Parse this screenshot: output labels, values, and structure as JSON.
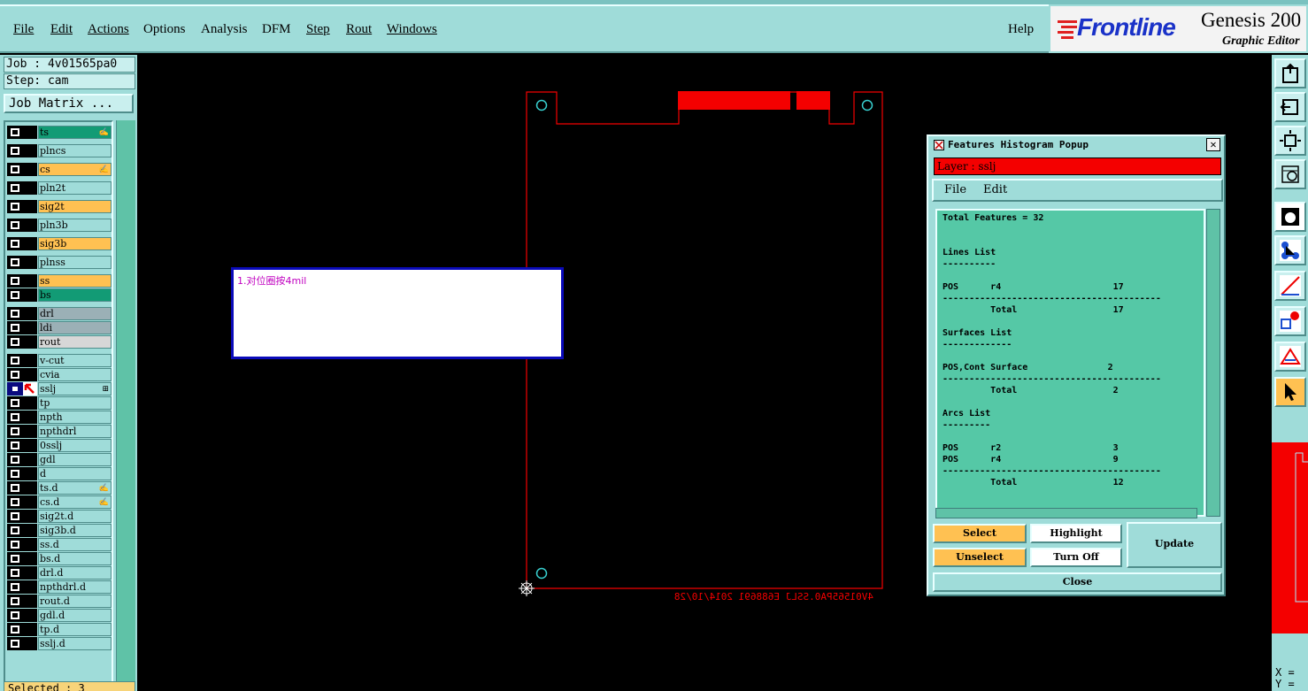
{
  "menubar": {
    "items": [
      "File",
      "Edit",
      "Actions",
      "Options",
      "Analysis",
      "DFM",
      "Step",
      "Rout",
      "Windows"
    ],
    "help": "Help"
  },
  "brand": {
    "logo_text": "Frontline",
    "product": "Genesis 200",
    "subtitle": "Graphic Editor"
  },
  "left_panel": {
    "job": "Job : 4v01565pa0",
    "step": "Step: cam",
    "job_matrix": "Job Matrix ...",
    "selected": "Selected : 3",
    "layers": [
      {
        "name": "ts",
        "color": "#129b75",
        "affected": false
      },
      {
        "name": "plncs",
        "color": "#9fdcd9",
        "affected": false
      },
      {
        "name": "cs",
        "color": "#ffc152",
        "affected": false
      },
      {
        "name": "pln2t",
        "color": "#9fdcd9",
        "affected": false
      },
      {
        "name": "sig2t",
        "color": "#ffc152",
        "affected": false
      },
      {
        "name": "pln3b",
        "color": "#9fdcd9",
        "affected": false
      },
      {
        "name": "sig3b",
        "color": "#ffc152",
        "affected": false
      },
      {
        "name": "plnss",
        "color": "#9fdcd9",
        "affected": false
      },
      {
        "name": "ss",
        "color": "#ffc152",
        "affected": false
      },
      {
        "name": "bs",
        "color": "#129b75",
        "affected": false
      },
      {
        "name": "drl",
        "color": "#9bb0b6",
        "affected": false
      },
      {
        "name": "ldi",
        "color": "#9bb0b6",
        "affected": false
      },
      {
        "name": "rout",
        "color": "#d7d7d7",
        "affected": false
      },
      {
        "name": "v-cut",
        "color": "#9fdcd9",
        "affected": false
      },
      {
        "name": "cvia",
        "color": "#9fdcd9",
        "affected": false
      },
      {
        "name": "sslj",
        "color": "#9fdcd9",
        "affected": true
      },
      {
        "name": "tp",
        "color": "#9fdcd9",
        "affected": false
      },
      {
        "name": "npth",
        "color": "#9fdcd9",
        "affected": false
      },
      {
        "name": "npthdrl",
        "color": "#9fdcd9",
        "affected": false
      },
      {
        "name": "0sslj",
        "color": "#9fdcd9",
        "affected": false
      },
      {
        "name": "gdl",
        "color": "#9fdcd9",
        "affected": false
      },
      {
        "name": "d",
        "color": "#9fdcd9",
        "affected": false
      },
      {
        "name": "ts.d",
        "color": "#9fdcd9",
        "affected": false
      },
      {
        "name": "cs.d",
        "color": "#9fdcd9",
        "affected": false
      },
      {
        "name": "sig2t.d",
        "color": "#9fdcd9",
        "affected": false
      },
      {
        "name": "sig3b.d",
        "color": "#9fdcd9",
        "affected": false
      },
      {
        "name": "ss.d",
        "color": "#9fdcd9",
        "affected": false
      },
      {
        "name": "bs.d",
        "color": "#9fdcd9",
        "affected": false
      },
      {
        "name": "drl.d",
        "color": "#9fdcd9",
        "affected": false
      },
      {
        "name": "npthdrl.d",
        "color": "#9fdcd9",
        "affected": false
      },
      {
        "name": "rout.d",
        "color": "#9fdcd9",
        "affected": false
      },
      {
        "name": "gdl.d",
        "color": "#9fdcd9",
        "affected": false
      },
      {
        "name": "tp.d",
        "color": "#9fdcd9",
        "affected": false
      },
      {
        "name": "sslj.d",
        "color": "#9fdcd9",
        "affected": false
      }
    ]
  },
  "canvas": {
    "board_text": "4V01565PA0.SSLJ E688691 2014/10/28",
    "note_text": "1.对位圈按4mil"
  },
  "popup": {
    "title": "Features Histogram Popup",
    "layer_label": "Layer :  sslj",
    "menu": [
      "File",
      "Edit"
    ],
    "report_lines": [
      "Total Features = 32",
      "",
      "",
      "Lines List",
      "----------",
      "",
      "POS      r4                     17",
      "-----------------------------------------",
      "         Total                  17",
      "",
      "Surfaces List",
      "-------------",
      "",
      "POS,Cont Surface               2",
      "-----------------------------------------",
      "         Total                  2",
      "",
      "Arcs List",
      "---------",
      "",
      "POS      r2                     3",
      "POS      r4                     9",
      "-----------------------------------------",
      "         Total                  12"
    ],
    "buttons": {
      "select": "Select",
      "unselect": "Unselect",
      "highlight": "Highlight",
      "turn_off": "Turn Off",
      "update": "Update",
      "close": "Close"
    },
    "colors": {
      "select_bg": "#ffc152",
      "report_bg": "#55c8a6",
      "layer_bar": "#f40000"
    }
  },
  "coords": {
    "x": "X =",
    "y": "Y ="
  }
}
